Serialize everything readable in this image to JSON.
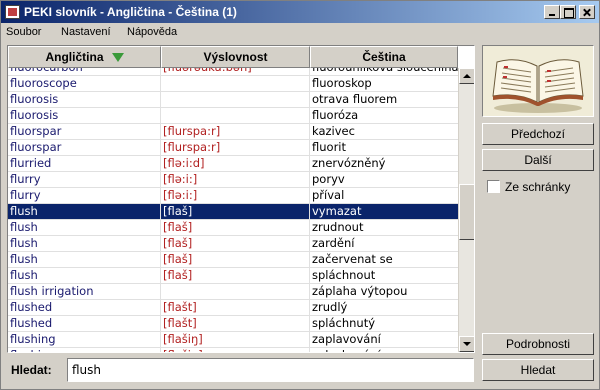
{
  "window": {
    "title": "PEKI slovník - Angličtina - Čeština  (1)"
  },
  "menu": [
    "Soubor",
    "Nastavení",
    "Nápověda"
  ],
  "table": {
    "columns": [
      "Angličtina",
      "Výslovnost",
      "Čeština"
    ],
    "sort_column": "Angličtina",
    "selected_index": 9,
    "rows": [
      [
        "fluorocarbon",
        "[fluərəuka:bən]",
        "fluorouhlíková sloučenina"
      ],
      [
        "fluoroscope",
        "",
        "fluoroskop"
      ],
      [
        "fluorosis",
        "",
        "otrava fluorem"
      ],
      [
        "fluorosis",
        "",
        "fluoróza"
      ],
      [
        "fluorspar",
        "[flurspa:r]",
        "kazivec"
      ],
      [
        "fluorspar",
        "[flurspa:r]",
        "fluorit"
      ],
      [
        "flurried",
        "[flə:i:d]",
        "znervózněný"
      ],
      [
        "flurry",
        "[flə:i:]",
        "poryv"
      ],
      [
        "flurry",
        "[flə:i:]",
        "příval"
      ],
      [
        "flush",
        "[flaš]",
        "vymazat"
      ],
      [
        "flush",
        "[flaš]",
        "zrudnout"
      ],
      [
        "flush",
        "[flaš]",
        "zardění"
      ],
      [
        "flush",
        "[flaš]",
        "začervenat se"
      ],
      [
        "flush",
        "[flaš]",
        "spláchnout"
      ],
      [
        "flush irrigation",
        "",
        "záplaha výtopou"
      ],
      [
        "flushed",
        "[flašt]",
        "zrudlý"
      ],
      [
        "flushed",
        "[flašt]",
        "spláchnutý"
      ],
      [
        "flushing",
        "[flašiŋ]",
        "zaplavování"
      ],
      [
        "flushing",
        "[flašiŋ]",
        "splachování"
      ]
    ]
  },
  "side": {
    "prev_label": "Předchozí",
    "next_label": "Další",
    "clipboard_label": "Ze schránky",
    "clipboard_checked": false,
    "details_label": "Podrobnosti",
    "search_button_label": "Hledat"
  },
  "search": {
    "label": "Hledat:",
    "value": "flush"
  },
  "colors": {
    "selection": "#0a246a",
    "pronunciation": "#b22222",
    "english": "#1a1a6e",
    "sort_arrow": "#3a9a3a"
  },
  "icons": [
    "app-icon",
    "sort-arrow-icon",
    "book-icon",
    "minimize-icon",
    "maximize-icon",
    "close-icon"
  ]
}
